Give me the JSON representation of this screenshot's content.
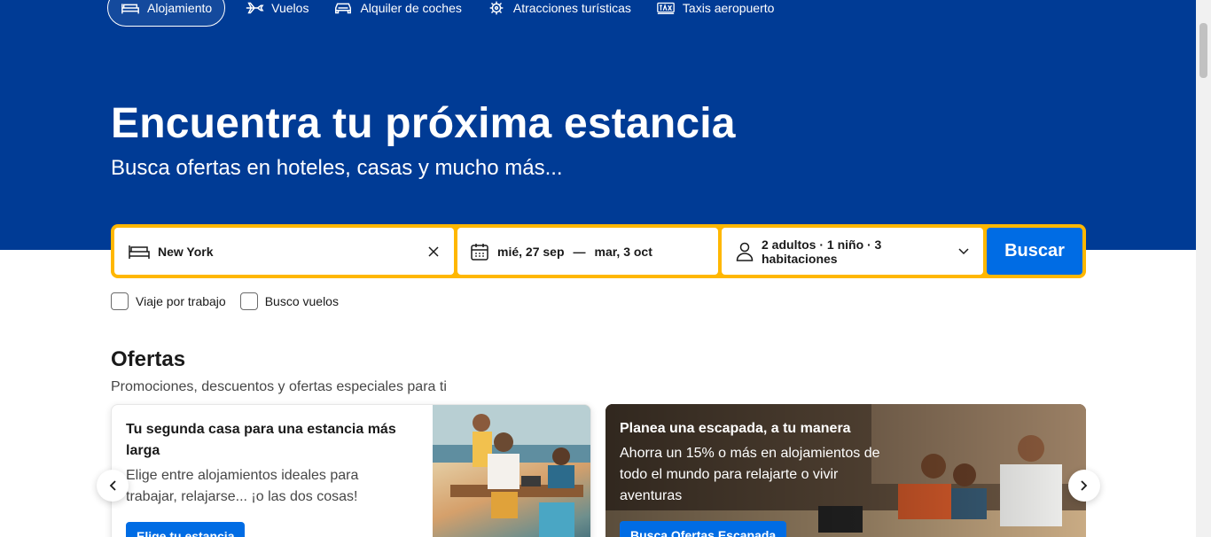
{
  "nav": {
    "items": [
      {
        "label": "Alojamiento",
        "icon": "bed-icon",
        "active": true
      },
      {
        "label": "Vuelos",
        "icon": "plane-icon",
        "active": false
      },
      {
        "label": "Alquiler de coches",
        "icon": "car-icon",
        "active": false
      },
      {
        "label": "Atracciones turísticas",
        "icon": "attraction-icon",
        "active": false
      },
      {
        "label": "Taxis aeropuerto",
        "icon": "taxi-icon",
        "active": false
      }
    ]
  },
  "hero": {
    "title": "Encuentra tu próxima estancia",
    "subtitle": "Busca ofertas en hoteles, casas y mucho más..."
  },
  "search": {
    "destination": "New York",
    "date_start": "mié, 27 sep",
    "date_separator": "—",
    "date_end": "mar, 3 oct",
    "guests": "2 adultos · 1 niño · 3 habitaciones",
    "button_label": "Buscar"
  },
  "checkboxes": [
    {
      "label": "Viaje por trabajo",
      "checked": false
    },
    {
      "label": "Busco vuelos",
      "checked": false
    }
  ],
  "offers": {
    "title": "Ofertas",
    "subtitle": "Promociones, descuentos y ofertas especiales para ti",
    "cards": [
      {
        "title": "Tu segunda casa para una estancia más larga",
        "description": "Elige entre alojamientos ideales para trabajar, relajarse... ¡o las dos cosas!",
        "button": "Elige tu estancia"
      },
      {
        "title": "Planea una escapada, a tu manera",
        "description": "Ahorra un 15% o más en alojamientos de todo el mundo para relajarte o vivir aventuras",
        "button": "Busca Ofertas Escapada"
      }
    ]
  },
  "colors": {
    "hero_blue": "#003b95",
    "accent_blue": "#006ce4",
    "search_border": "#ffb700"
  }
}
